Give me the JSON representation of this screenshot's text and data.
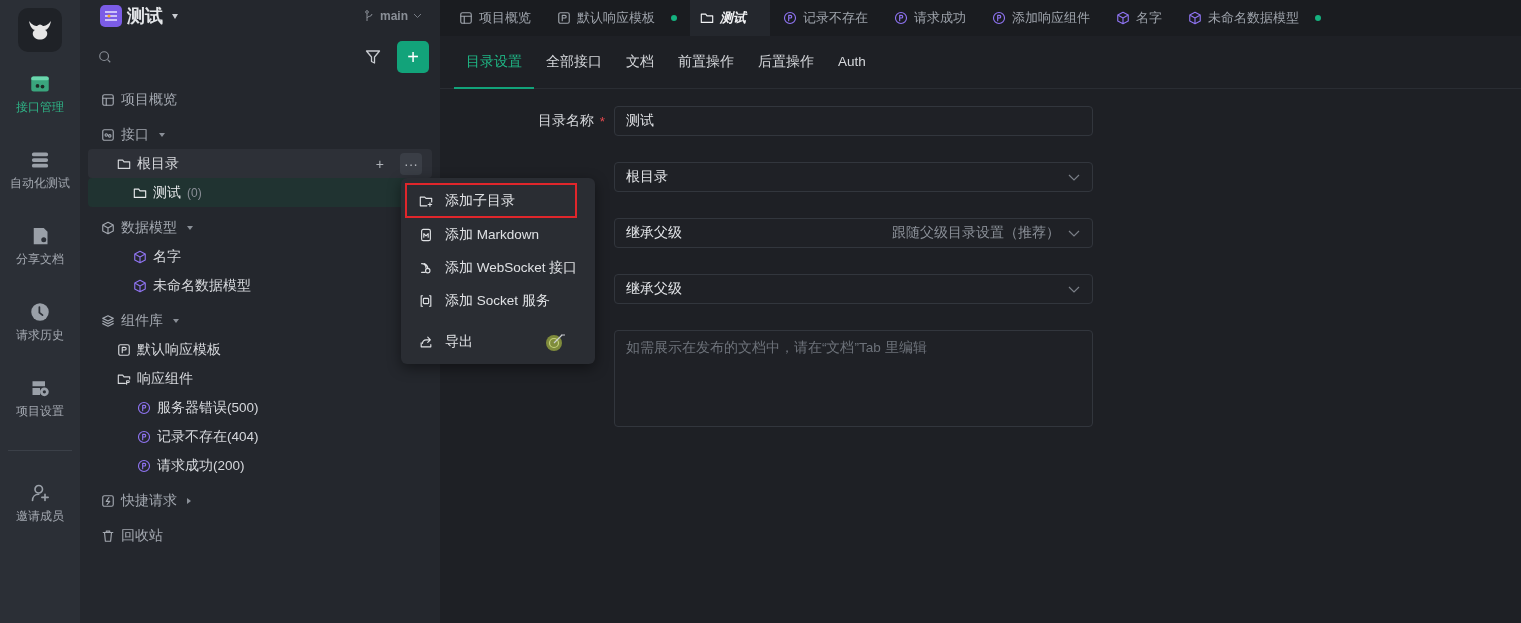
{
  "app": {
    "project": "测试",
    "branch": "main"
  },
  "rail": [
    {
      "label": "接口管理",
      "selected": true
    },
    {
      "label": "自动化测试",
      "selected": false
    },
    {
      "label": "分享文档",
      "selected": false
    },
    {
      "label": "请求历史",
      "selected": false
    },
    {
      "label": "项目设置",
      "selected": false
    },
    {
      "label": "邀请成员",
      "selected": false
    }
  ],
  "add_button": "+",
  "sidebar": {
    "tree": [
      {
        "kind": "overview",
        "label": "项目概览"
      },
      {
        "kind": "apis",
        "label": "接口",
        "expanded": true,
        "children": [
          {
            "kind": "folder",
            "label": "根目录",
            "selected": false,
            "actions": [
              "+",
              "···"
            ],
            "children": [
              {
                "kind": "folder",
                "label": "测试",
                "count": "(0)",
                "selected": true
              }
            ]
          }
        ]
      },
      {
        "kind": "models",
        "label": "数据模型",
        "expanded": true,
        "children": [
          {
            "kind": "model",
            "label": "名字"
          },
          {
            "kind": "model",
            "label": "未命名数据模型"
          }
        ]
      },
      {
        "kind": "components",
        "label": "组件库",
        "expanded": true,
        "children": [
          {
            "kind": "template",
            "label": "默认响应模板"
          },
          {
            "kind": "responses",
            "label": "响应组件",
            "children": [
              {
                "kind": "response",
                "label": "服务器错误(500)"
              },
              {
                "kind": "response",
                "label": "记录不存在(404)"
              },
              {
                "kind": "response",
                "label": "请求成功(200)"
              }
            ]
          }
        ]
      },
      {
        "kind": "shortcuts",
        "label": "快捷请求",
        "expanded": false
      },
      {
        "kind": "trash",
        "label": "回收站"
      }
    ]
  },
  "tabs": [
    {
      "kind": "overview",
      "label": "项目概览",
      "selected": false,
      "unsaved": false
    },
    {
      "kind": "template",
      "label": "默认响应模板",
      "selected": false,
      "unsaved": true
    },
    {
      "kind": "folder",
      "label": "测试",
      "selected": true,
      "unsaved": false
    },
    {
      "kind": "response",
      "label": "记录不存在",
      "selected": false,
      "unsaved": false
    },
    {
      "kind": "response",
      "label": "请求成功",
      "selected": false,
      "unsaved": false
    },
    {
      "kind": "response",
      "label": "添加响应组件",
      "selected": false,
      "unsaved": false
    },
    {
      "kind": "model",
      "label": "名字",
      "selected": false,
      "unsaved": false
    },
    {
      "kind": "model",
      "label": "未命名数据模型",
      "selected": false,
      "unsaved": true
    }
  ],
  "subtabs": [
    {
      "label": "目录设置",
      "selected": true
    },
    {
      "label": "全部接口",
      "selected": false
    },
    {
      "label": "文档",
      "selected": false
    },
    {
      "label": "前置操作",
      "selected": false
    },
    {
      "label": "后置操作",
      "selected": false
    },
    {
      "label": "Auth",
      "selected": false
    }
  ],
  "form": [
    {
      "kind": "input",
      "label": "目录名称",
      "required_mark": "*",
      "value": "测试"
    },
    {
      "kind": "select",
      "value": "根目录"
    },
    {
      "kind": "select",
      "value": "继承父级",
      "hint": "跟随父级目录设置（推荐）"
    },
    {
      "kind": "select",
      "value": "继承父级"
    },
    {
      "kind": "textarea",
      "placeholder": "如需展示在发布的文档中，请在“文档”Tab 里编辑"
    }
  ],
  "menu": [
    {
      "kind": "folder",
      "label": "添加子目录",
      "highlighted": true
    },
    {
      "kind": "markdown",
      "label": "添加 Markdown",
      "highlighted": false
    },
    {
      "kind": "websocket",
      "label": "添加 WebSocket 接口",
      "highlighted": false
    },
    {
      "kind": "socket",
      "label": "添加 Socket 服务",
      "highlighted": false
    },
    {
      "kind": "export",
      "label": "导出",
      "highlighted": false
    }
  ]
}
